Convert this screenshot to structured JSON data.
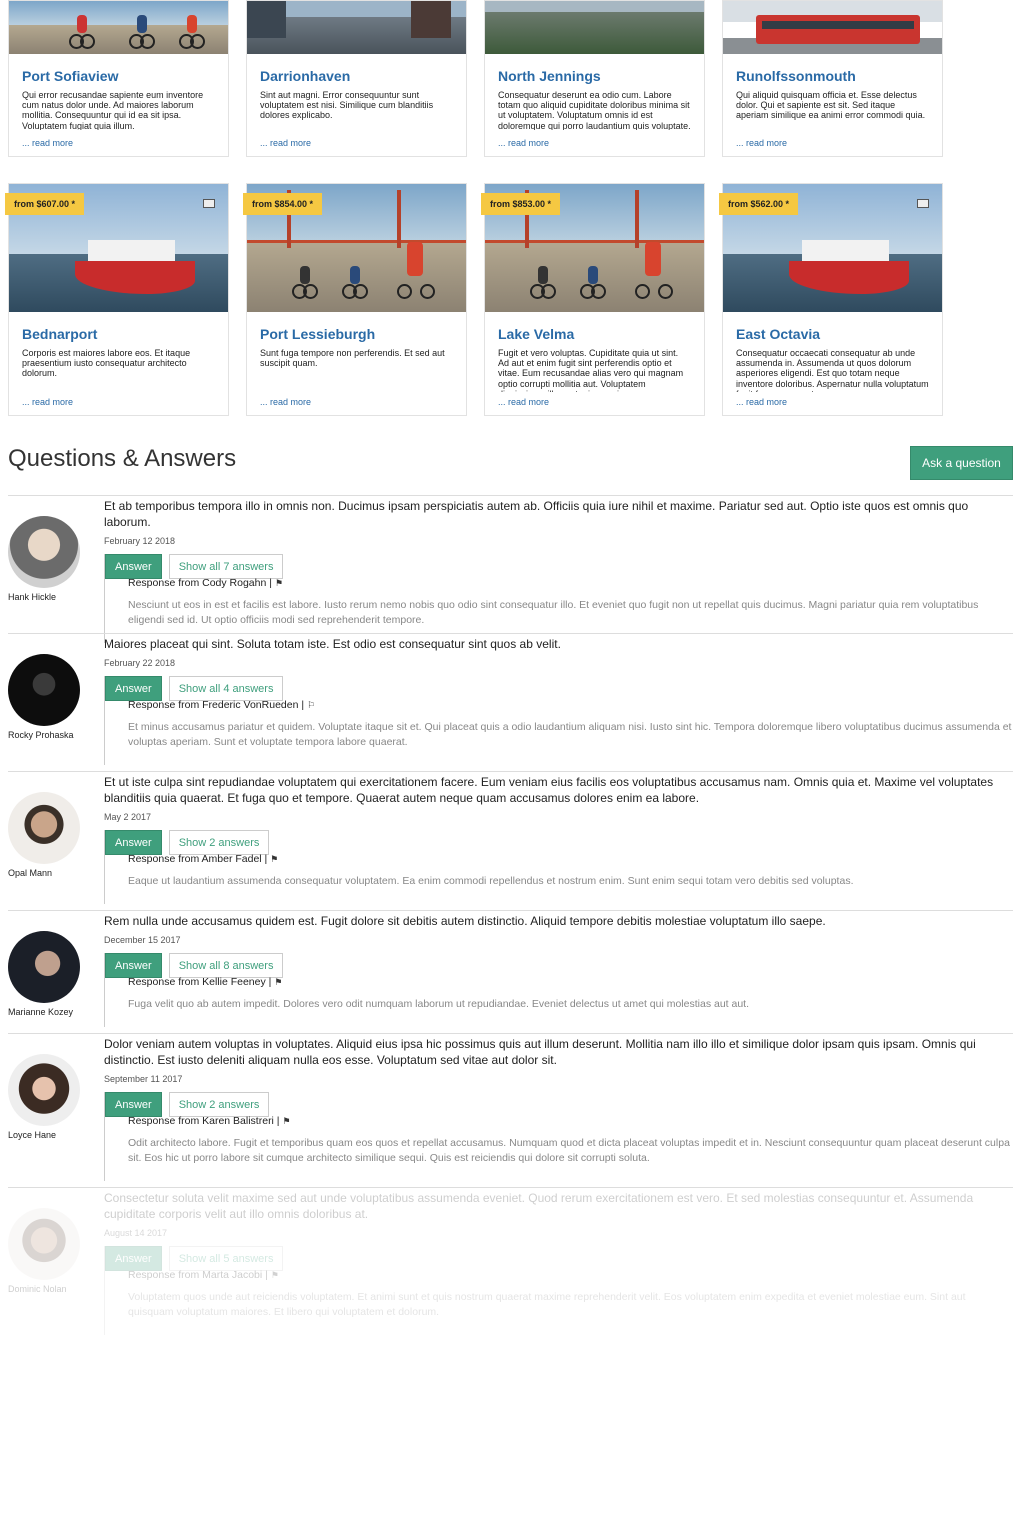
{
  "tours_row1": [
    {
      "title": "Port Sofiaview",
      "desc": "Qui error recusandae sapiente eum inventore cum natus dolor unde. Ad maiores laborum mollitia. Consequuntur qui id ea sit ipsa. Voluptatem fugiat quia illum.",
      "read_more": "... read more",
      "image": "bike-tour-photo"
    },
    {
      "title": "Darrionhaven",
      "desc": "Sint aut magni. Error consequuntur sunt voluptatem est nisi. Similique cum blanditiis dolores explicabo.",
      "read_more": "... read more",
      "image": "city-photo"
    },
    {
      "title": "North Jennings",
      "desc": "Consequatur deserunt ea odio cum. Labore totam quo aliquid cupiditate doloribus minima sit ut voluptatem. Voluptatum omnis id est doloremque qui porro laudantium quis voluptate. Voluptas magni facere id velit est.",
      "read_more": "... read more",
      "image": "forest-photo"
    },
    {
      "title": "Runolfssonmouth",
      "desc": "Qui aliquid quisquam officia et. Esse delectus dolor. Qui et sapiente est sit. Sed itaque aperiam similique ea animi error commodi quia.",
      "read_more": "... read more",
      "image": "bus-photo"
    }
  ],
  "tours_row2": [
    {
      "price": "from $607.00 *",
      "title": "Bednarport",
      "desc": "Corporis est maiores labore eos. Et itaque praesentium iusto consequatur architecto dolorum.",
      "read_more": "... read more",
      "image": "boat-photo"
    },
    {
      "price": "from $854.00 *",
      "title": "Port Lessieburgh",
      "desc": "Sunt fuga tempore non perferendis. Et sed aut suscipit quam.",
      "read_more": "... read more",
      "image": "bike-tour-photo"
    },
    {
      "price": "from $853.00 *",
      "title": "Lake Velma",
      "desc": "Fugit et vero voluptas. Cupiditate quia ut sint. Ad aut et enim fugit sint perferendis optio et vitae. Eum recusandae alias vero qui magnam optio corrupti mollitia aut. Voluptatem dignissimos illo sunt minus qui.",
      "read_more": "... read more",
      "image": "bike-tour-photo"
    },
    {
      "price": "from $562.00 *",
      "title": "East Octavia",
      "desc": "Consequatur occaecati consequatur ab unde assumenda in. Assumenda ut quos dolorum asperiores eligendi. Est quo totam neque inventore doloribus. Aspernatur nulla voluptatum fugit facere porro et cum.",
      "read_more": "... read more",
      "image": "boat-photo"
    }
  ],
  "qa": {
    "title": "Questions & Answers",
    "ask_button": "Ask a question",
    "answer_label": "Answer",
    "items": [
      {
        "user": "Hank Hickle",
        "question": "Et ab temporibus tempora illo in omnis non. Ducimus ipsam perspiciatis autem ab. Officiis quia iure nihil et maxime. Pariatur sed aut. Optio iste quos est omnis quo laborum.",
        "date": "February 12 2018",
        "show_label": "Show all 7 answers",
        "response_from": "Response from Cody Rogahn |",
        "flag": "⚑",
        "response": "Nesciunt ut eos in est et facilis est labore. Iusto rerum nemo nobis quo odio sint consequatur illo. Et eveniet quo fugit non ut repellat quis ducimus. Magni pariatur quia rem voluptatibus eligendi sed id. Ut optio officiis modi sed reprehenderit tempore.",
        "avatar_color": "#b9b9b9"
      },
      {
        "user": "Rocky Prohaska",
        "question": "Maiores placeat qui sint. Soluta totam iste. Est odio est consequatur sint quos ab velit.",
        "date": "February 22 2018",
        "show_label": "Show all 4 answers",
        "response_from": "Response from Frederic VonRueden |",
        "flag": "⚐",
        "response": "Et minus accusamus pariatur et quidem. Voluptate itaque sit et. Qui placeat quis a odio laudantium aliquam nisi. Iusto sint hic. Tempora doloremque libero voluptatibus ducimus assumenda et voluptas aperiam. Sunt et voluptate tempora labore quaerat.",
        "avatar_color": "#111111"
      },
      {
        "user": "Opal Mann",
        "question": "Et ut iste culpa sint repudiandae voluptatem qui exercitationem facere. Eum veniam eius facilis eos voluptatibus accusamus nam. Omnis quia et. Maxime vel voluptates blanditiis quia quaerat. Et fuga quo et tempore. Quaerat autem neque quam accusamus dolores enim ea labore.",
        "date": "May 2 2017",
        "show_label": "Show 2 answers",
        "response_from": "Response from Amber Fadel |",
        "flag": "⚑",
        "response": "Eaque ut laudantium assumenda consequatur voluptatem. Ea enim commodi repellendus et nostrum enim. Sunt enim sequi totam vero debitis sed voluptas.",
        "avatar_color": "#d9d4cf"
      },
      {
        "user": "Marianne Kozey",
        "question": "Rem nulla unde accusamus quidem est. Fugit dolore sit debitis autem distinctio. Aliquid tempore debitis molestiae voluptatum illo saepe.",
        "date": "December 15 2017",
        "show_label": "Show all 8 answers",
        "response_from": "Response from Kellie Feeney |",
        "flag": "⚑",
        "response": "Fuga velit quo ab autem impedit. Dolores vero odit numquam laborum ut repudiandae. Eveniet delectus ut amet qui molestias aut aut.",
        "avatar_color": "#1d2733"
      },
      {
        "user": "Loyce Hane",
        "question": "Dolor veniam autem voluptas in voluptates. Aliquid eius ipsa hic possimus quis aut illum deserunt. Mollitia nam illo illo et similique dolor ipsam quis ipsam. Omnis qui distinctio. Est iusto deleniti aliquam nulla eos esse. Voluptatum sed vitae aut dolor sit.",
        "date": "September 11 2017",
        "show_label": "Show 2 answers",
        "response_from": "Response from Karen Balistreri |",
        "flag": "⚑",
        "response": "Odit architecto labore. Fugit et temporibus quam eos quos et repellat accusamus. Numquam quod et dicta placeat voluptas impedit et in. Nesciunt consequuntur quam placeat deserunt culpa sit. Eos hic ut porro labore sit cumque architecto similique sequi. Quis est reiciendis qui dolore sit corrupti soluta.",
        "avatar_color": "#cfc6bf"
      },
      {
        "user": "Dominic Nolan",
        "question": "Consectetur soluta velit maxime sed aut unde voluptatibus assumenda eveniet. Quod rerum exercitationem est vero. Et sed molestias consequuntur et. Assumenda cupiditate corporis velit aut illo omnis doloribus at.",
        "date": "August 14 2017",
        "show_label": "Show all 5 answers",
        "response_from": "Response from Marta Jacobi |",
        "flag": "⚑",
        "response": "Voluptatem quos unde aut reiciendis voluptatem. Et animi sunt et quis nostrum quaerat maxime reprehenderit velit. Eos voluptatem enim expedita et eveniet molestiae eum. Sint aut quisquam voluptatum maiores. Et libero qui voluptatem et dolorum.",
        "avatar_color": "#8a7466"
      }
    ]
  }
}
